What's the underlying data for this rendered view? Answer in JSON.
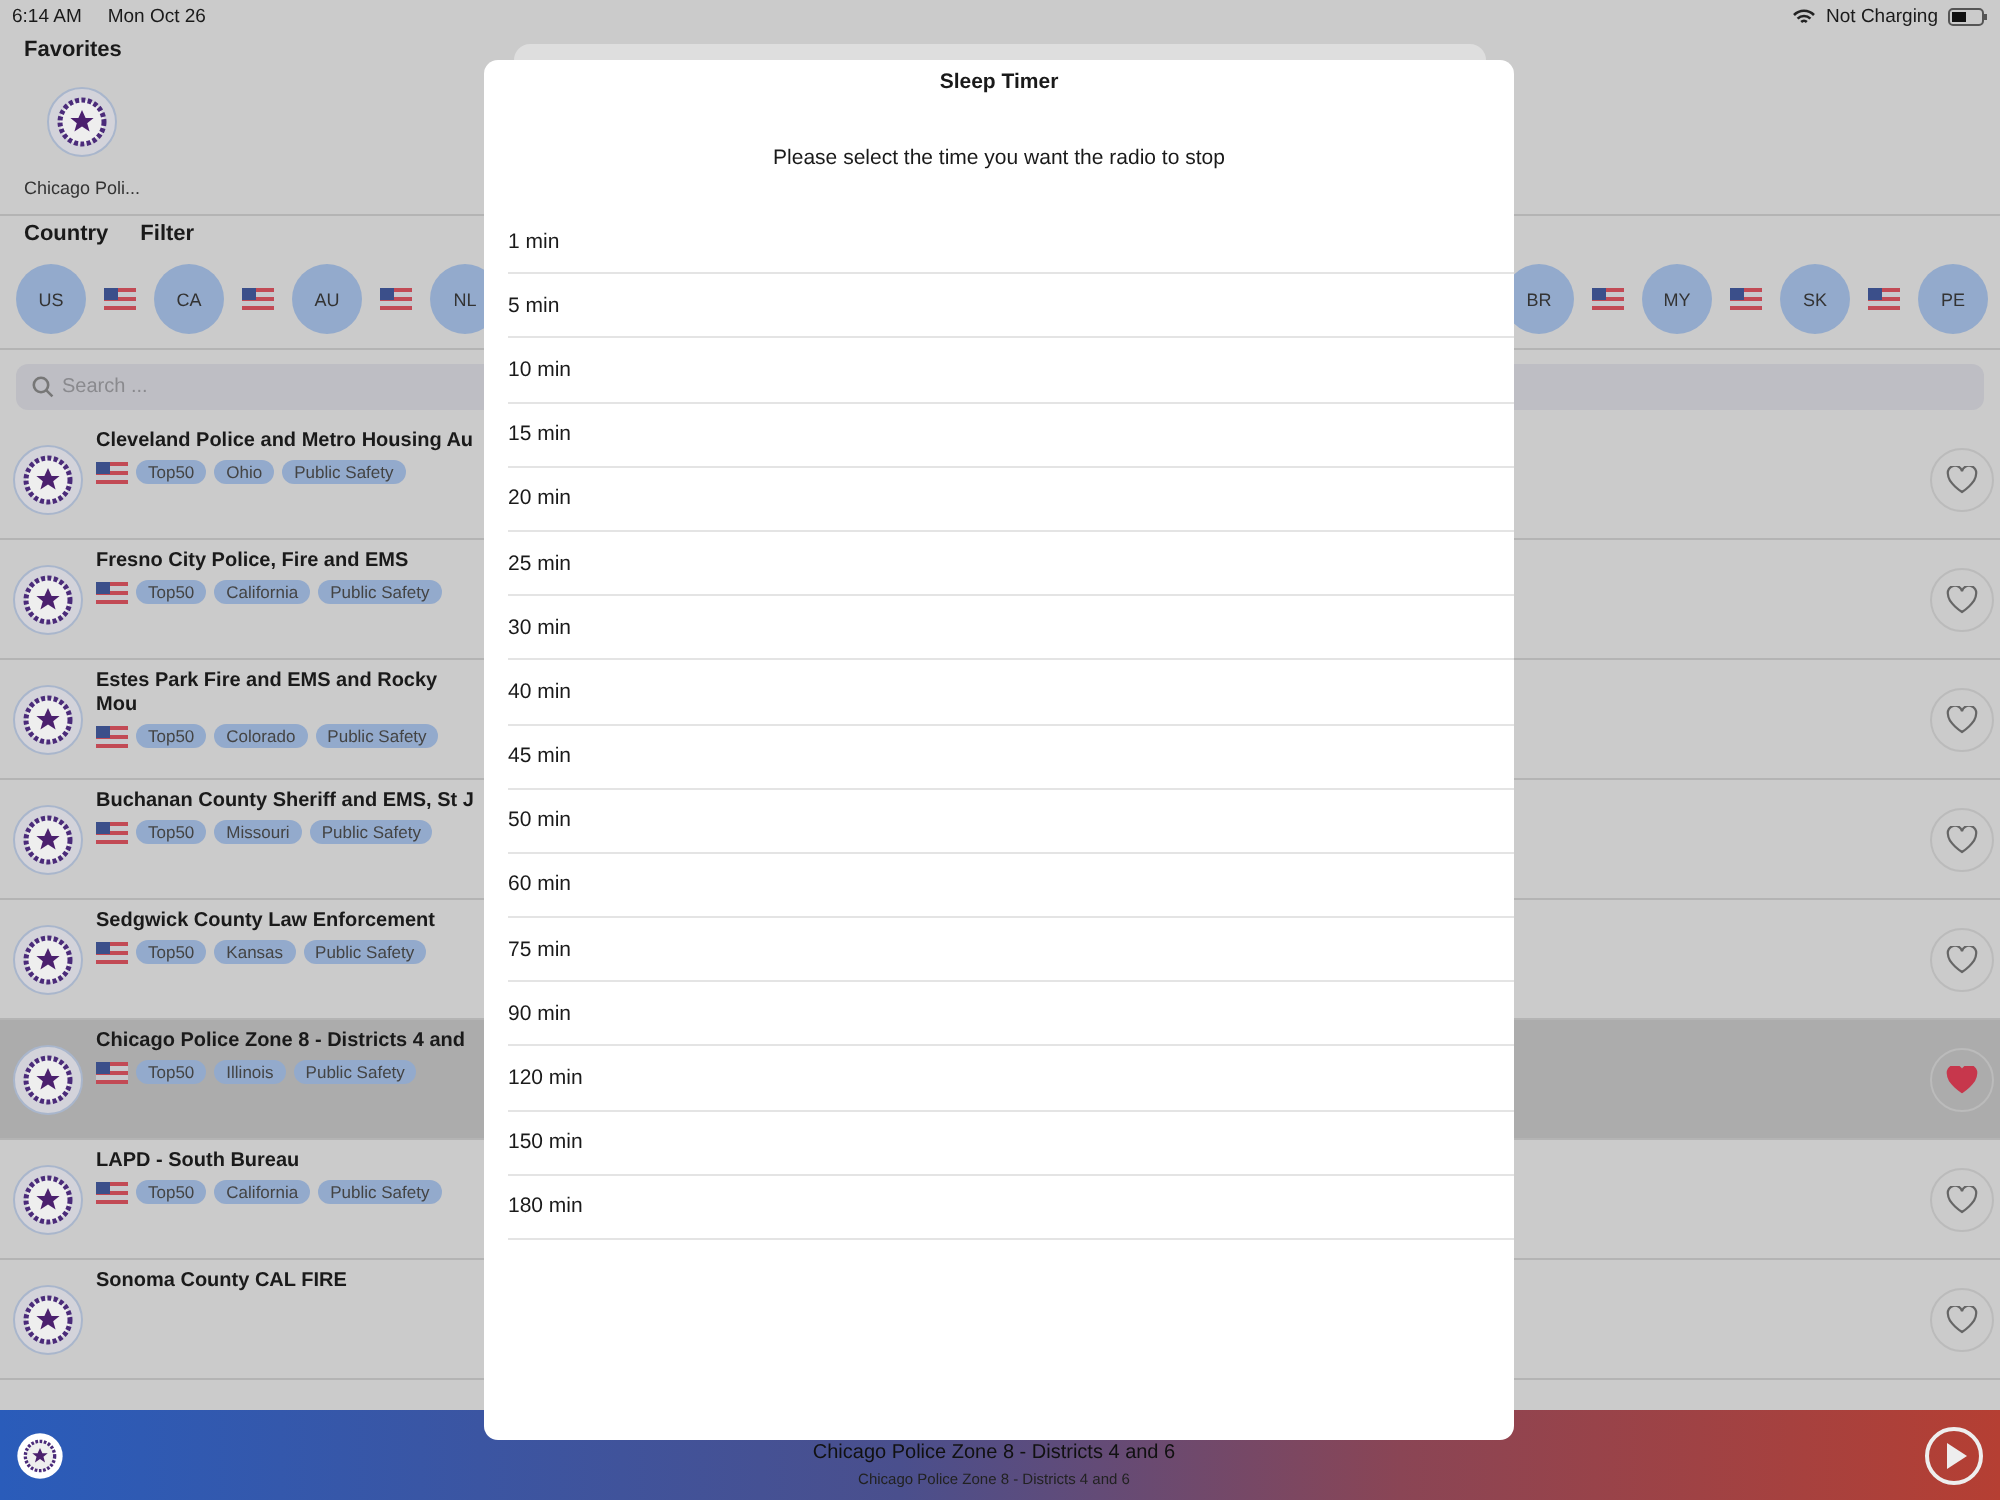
{
  "status_bar": {
    "time": "6:14 AM",
    "date": "Mon Oct 26",
    "battery_text": "Not Charging"
  },
  "favorites": {
    "title": "Favorites",
    "items": [
      {
        "label": "Chicago Poli..."
      }
    ]
  },
  "tabs": [
    {
      "label": "Country"
    },
    {
      "label": "Filter"
    }
  ],
  "countries_left": [
    "US",
    "CA",
    "AU",
    "NL"
  ],
  "countries_right": [
    "BR",
    "MY",
    "SK",
    "PE"
  ],
  "search": {
    "placeholder": "Search ..."
  },
  "stations": [
    {
      "name": "Cleveland Police and Metro Housing Au",
      "tags": [
        "Top50",
        "Ohio",
        "Public Safety"
      ],
      "favorite": false,
      "selected": false
    },
    {
      "name": "Fresno City Police, Fire and EMS",
      "tags": [
        "Top50",
        "California",
        "Public Safety"
      ],
      "favorite": false,
      "selected": false
    },
    {
      "name": "Estes Park Fire and EMS and Rocky Mou",
      "tags": [
        "Top50",
        "Colorado",
        "Public Safety"
      ],
      "favorite": false,
      "selected": false
    },
    {
      "name": "Buchanan County Sheriff and EMS, St J",
      "tags": [
        "Top50",
        "Missouri",
        "Public Safety"
      ],
      "favorite": false,
      "selected": false
    },
    {
      "name": "Sedgwick County Law Enforcement",
      "tags": [
        "Top50",
        "Kansas",
        "Public Safety"
      ],
      "favorite": false,
      "selected": false
    },
    {
      "name": "Chicago Police Zone 8 - Districts 4 and",
      "tags": [
        "Top50",
        "Illinois",
        "Public Safety"
      ],
      "favorite": true,
      "selected": true
    },
    {
      "name": "LAPD - South Bureau",
      "tags": [
        "Top50",
        "California",
        "Public Safety"
      ],
      "favorite": false,
      "selected": false
    },
    {
      "name": "Sonoma County CAL FIRE",
      "favorite": false,
      "selected": false
    }
  ],
  "player": {
    "title": "Chicago Police Zone 8 - Districts 4 and 6",
    "subtitle": "Chicago Police Zone 8 - Districts 4 and 6"
  },
  "sleep_timer": {
    "title": "Sleep Timer",
    "message": "Please select the time you want the radio to stop",
    "options": [
      "1 min",
      "5 min",
      "10 min",
      "15 min",
      "20 min",
      "25 min",
      "30 min",
      "40 min",
      "45 min",
      "50 min",
      "60 min",
      "75 min",
      "90 min",
      "120 min",
      "150 min",
      "180 min"
    ]
  }
}
